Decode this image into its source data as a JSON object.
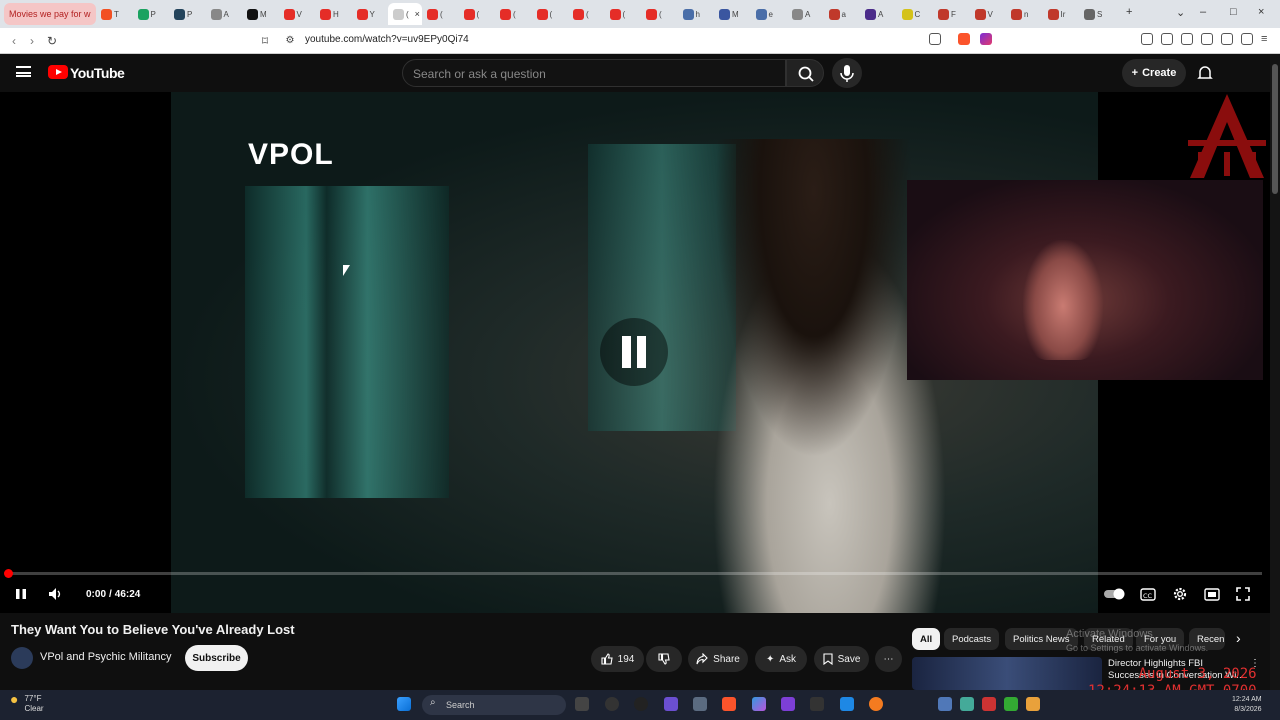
{
  "browser": {
    "first_tab_title": "Movies we pay for w",
    "active_tab_close": "×",
    "url": "youtube.com/watch?v=uv9EPy0Qi74",
    "window_controls": [
      "–",
      "□",
      "×"
    ],
    "tabs": [
      {
        "letter": "T",
        "color": "#f25022"
      },
      {
        "letter": "P",
        "color": "#1aa260"
      },
      {
        "letter": "P",
        "color": "#24445c"
      },
      {
        "letter": "A",
        "color": "#888888"
      },
      {
        "letter": "M",
        "color": "#111111"
      },
      {
        "letter": "V",
        "color": "#e52d27"
      },
      {
        "letter": "H",
        "color": "#e52d27"
      },
      {
        "letter": "Y",
        "color": "#e52d27"
      },
      {
        "letter": "(",
        "color": "#cccccc",
        "active": true
      },
      {
        "letter": "(",
        "color": "#e52d27"
      },
      {
        "letter": "(",
        "color": "#e52d27"
      },
      {
        "letter": "(",
        "color": "#e52d27"
      },
      {
        "letter": "(",
        "color": "#e52d27"
      },
      {
        "letter": "(",
        "color": "#e52d27"
      },
      {
        "letter": "(",
        "color": "#e52d27"
      },
      {
        "letter": "(",
        "color": "#e52d27"
      },
      {
        "letter": "h",
        "color": "#4a6ea8"
      },
      {
        "letter": "M",
        "color": "#3a56a0"
      },
      {
        "letter": "e",
        "color": "#4a6ea8"
      },
      {
        "letter": "A",
        "color": "#888888"
      },
      {
        "letter": "a",
        "color": "#c0392b"
      },
      {
        "letter": "A",
        "color": "#4b2c8a"
      },
      {
        "letter": "C",
        "color": "#d4c21a"
      },
      {
        "letter": "F",
        "color": "#c0392b"
      },
      {
        "letter": "V",
        "color": "#c0392b"
      },
      {
        "letter": "n",
        "color": "#c0392b"
      },
      {
        "letter": "Ir",
        "color": "#c0392b"
      },
      {
        "letter": "S",
        "color": "#666666"
      }
    ]
  },
  "youtube": {
    "logo_text": "YouTube",
    "search_placeholder": "Search or ask a question",
    "create_label": "Create",
    "create_plus": "+"
  },
  "player": {
    "overlay_logo": "VPOL",
    "time_current": "0:00",
    "time_total": "46:24",
    "progress_fraction": 0.0
  },
  "video": {
    "title": "They Want You to Believe You've Already Lost",
    "channel": "VPol and Psychic Militancy",
    "subscribe_label": "Subscribe",
    "likes": "194",
    "share_label": "Share",
    "ask_label": "Ask",
    "save_label": "Save",
    "more_label": "⋯"
  },
  "chips": [
    "All",
    "Podcasts",
    "Politics News",
    "Related",
    "For you",
    "Recen"
  ],
  "recommendation": {
    "title_line1": "Director Highlights FBI",
    "title_line2": "Successes in Conversation Wi..."
  },
  "overlays": {
    "activate_line1": "Activate Windows",
    "activate_line2": "Go to Settings to activate Windows.",
    "date_red": "August 3, 2026",
    "time_red": "12:24:13 AM GMT-0700"
  },
  "taskbar": {
    "weather_temp": "77°F",
    "weather_desc": "Clear",
    "search_label": "Search",
    "clock_time": "12:24 AM",
    "clock_date": "8/3/2026"
  },
  "colors": {
    "accent": "#ff0000",
    "yt_bg": "#0f0f0f",
    "chip_bg": "#272727"
  }
}
